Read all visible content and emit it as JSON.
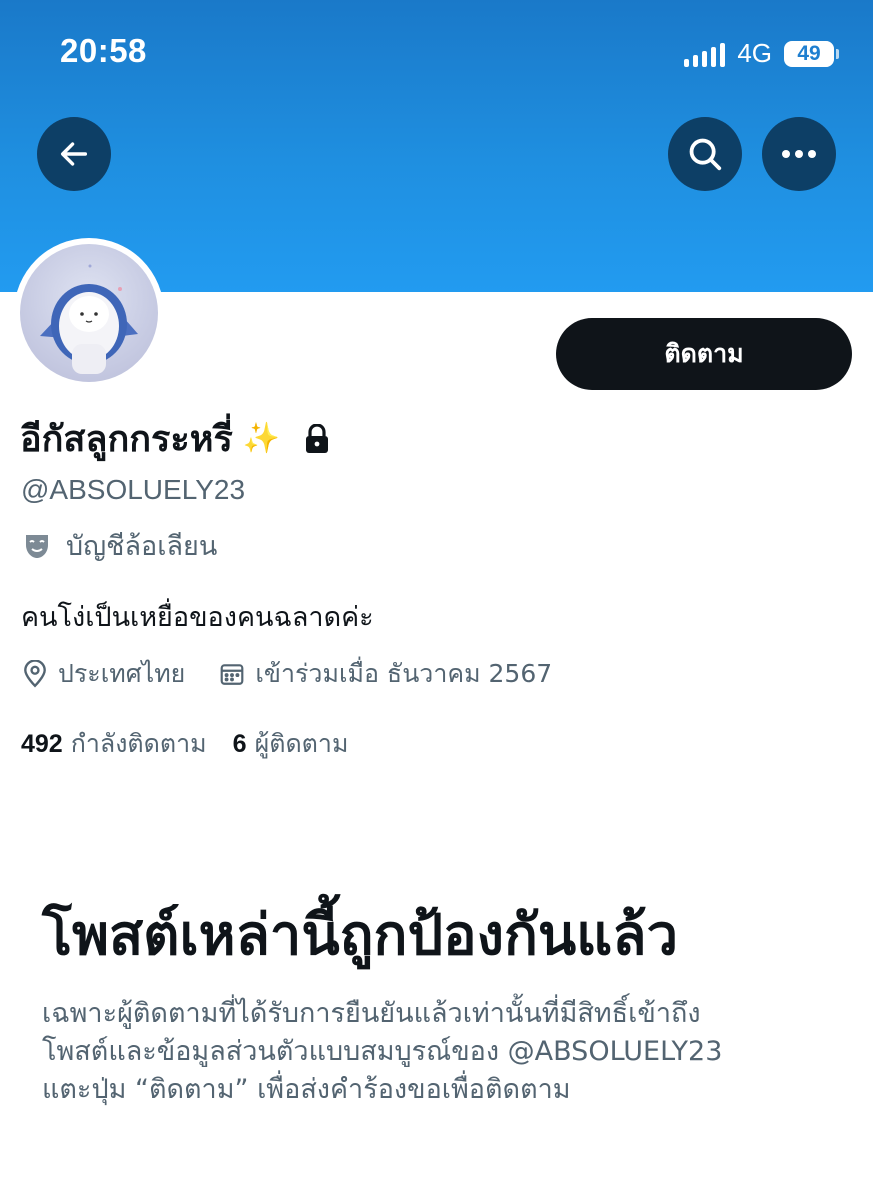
{
  "status_bar": {
    "time": "20:58",
    "network": "4G",
    "battery": "49",
    "battery_level_percent": 49
  },
  "colors": {
    "banner": "#1f8fe0",
    "nav_button_bg": "#0d3f66",
    "follow_button_bg": "#0f1419",
    "secondary_text": "#536471",
    "primary_text": "#0f1419"
  },
  "icons": {
    "back": "arrow-left-icon",
    "search": "search-icon",
    "more": "more-dots-icon",
    "lock": "lock-icon",
    "parody": "theater-mask-icon",
    "location": "location-pin-icon",
    "calendar": "calendar-icon"
  },
  "profile": {
    "display_name": "อีกัสลูกกระหรี่",
    "emoji": "✨",
    "handle": "@ABSOLUELY23",
    "parody_label": "บัญชีล้อเลียน",
    "bio": "คนโง่เป็นเหยื่อของคนฉลาดค่ะ",
    "location": "ประเทศไทย",
    "joined": "เข้าร่วมเมื่อ ธันวาคม 2567",
    "following_count": "492",
    "following_label": "กำลังติดตาม",
    "followers_count": "6",
    "followers_label": "ผู้ติดตาม"
  },
  "follow_button": {
    "label": "ติดตาม"
  },
  "protected_notice": {
    "title": "โพสต์เหล่านี้ถูกป้องกันแล้ว",
    "line1": "เฉพาะผู้ติดตามที่ได้รับการยืนยันแล้วเท่านั้นที่มีสิทธิ์เข้าถึง",
    "line2": "โพสต์และข้อมูลส่วนตัวแบบสมบูรณ์ของ @ABSOLUELY23",
    "line3": "แตะปุ่ม “ติดตาม” เพื่อส่งคำร้องขอเพื่อติดตาม"
  }
}
